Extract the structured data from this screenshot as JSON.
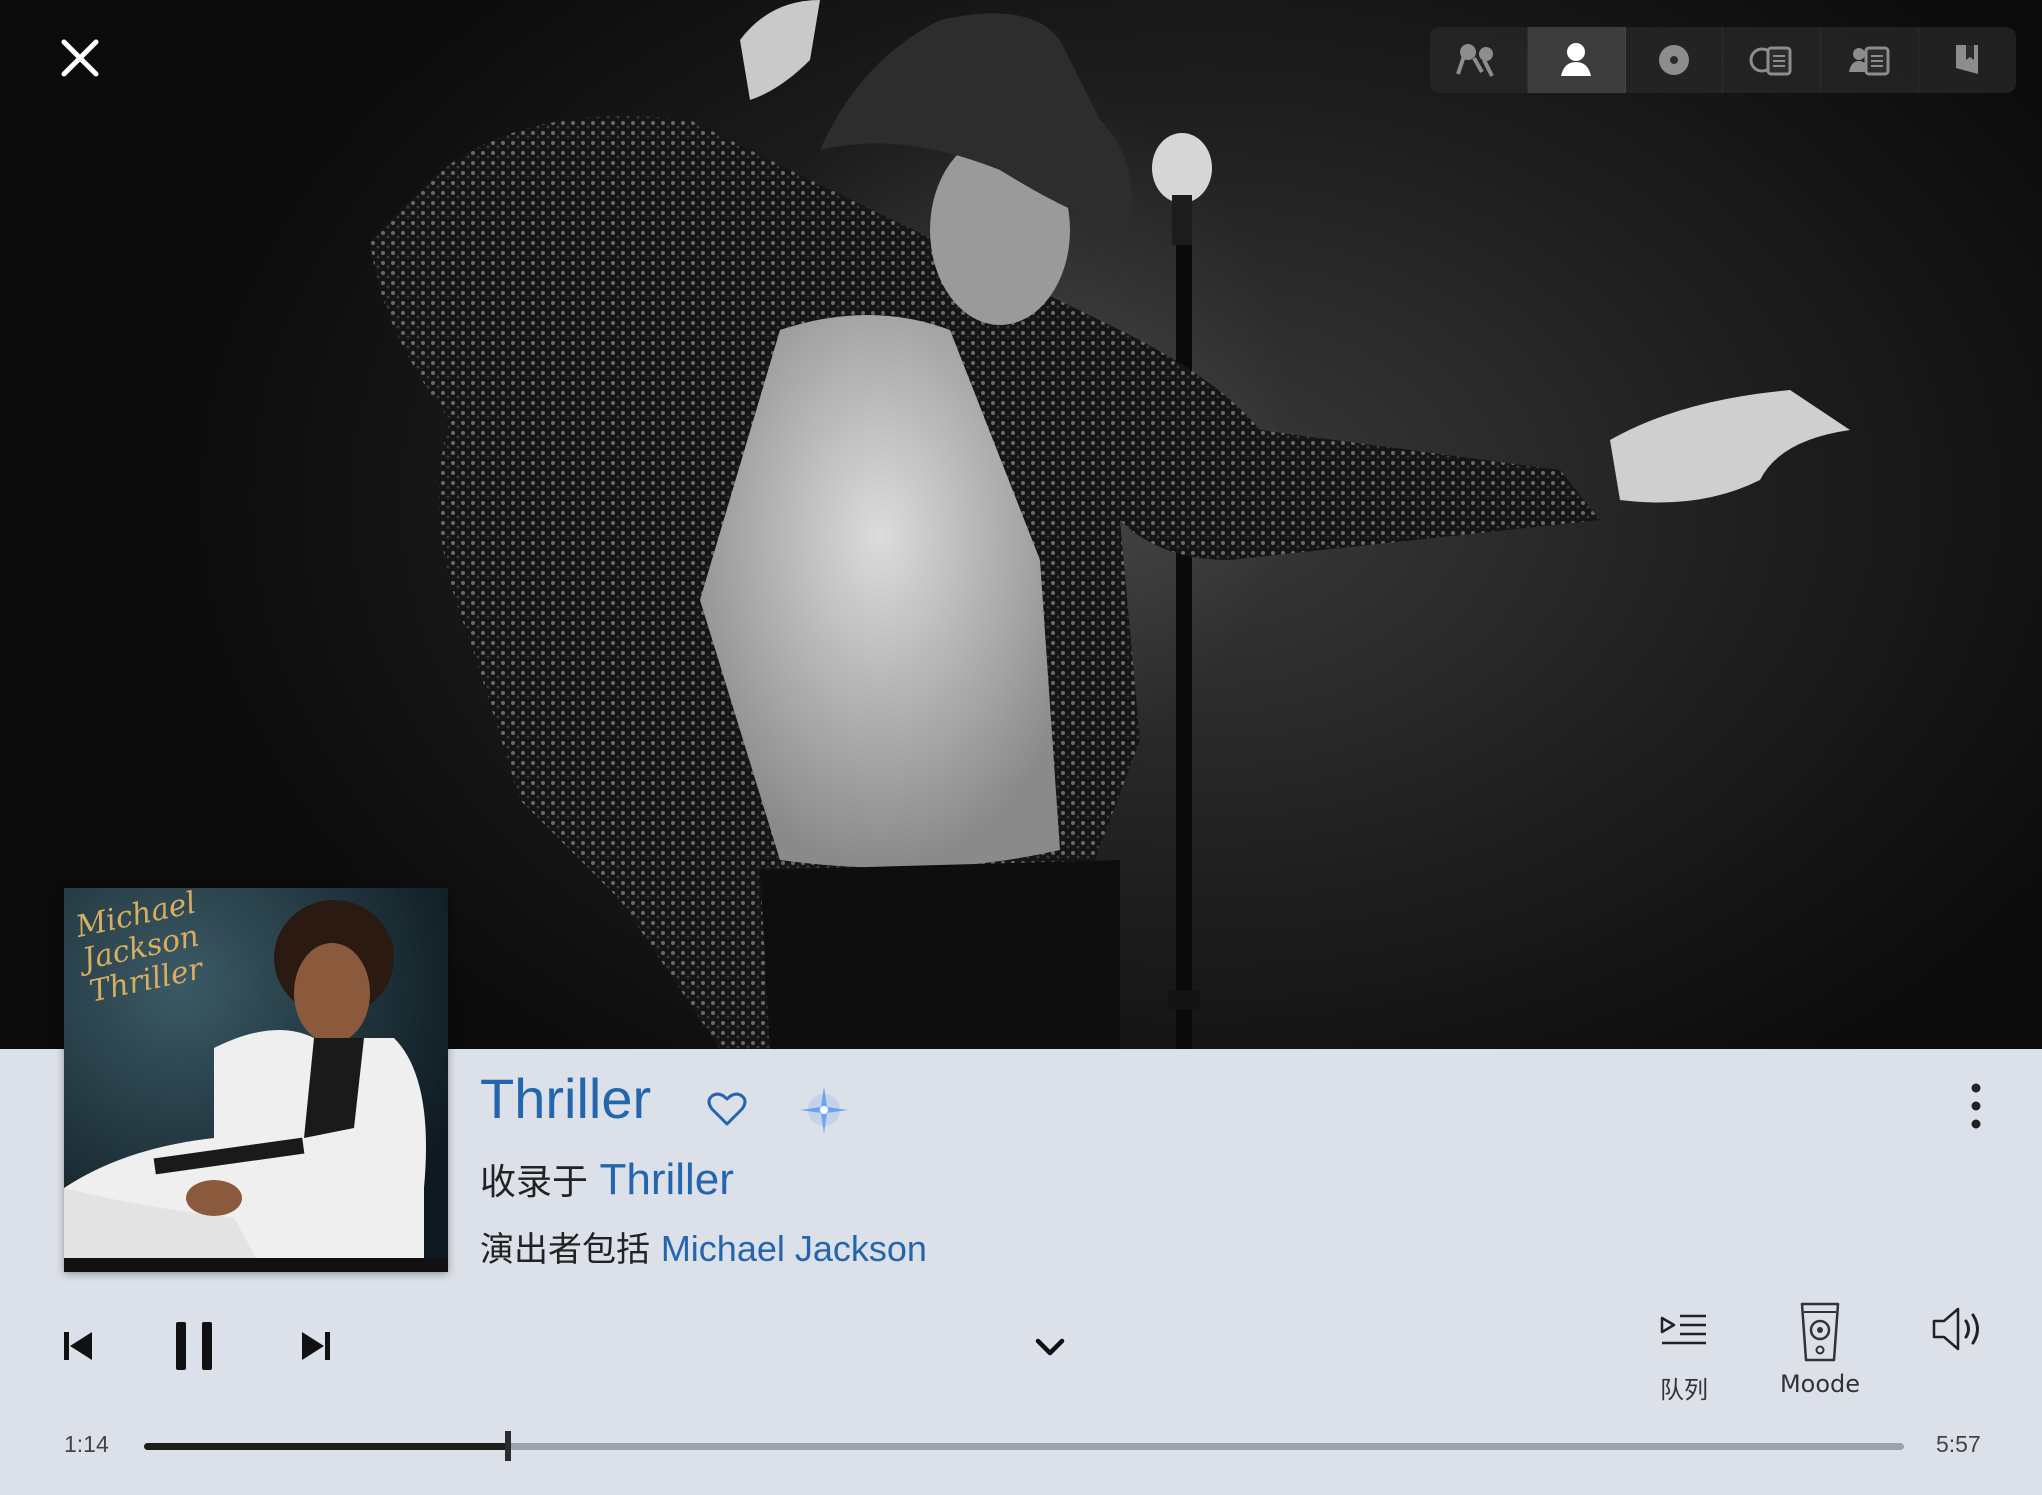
{
  "topbar": {
    "close_icon": "close-icon",
    "view_buttons": [
      {
        "name": "mic-view-icon",
        "active": false
      },
      {
        "name": "artist-view-icon",
        "active": true
      },
      {
        "name": "disc-view-icon",
        "active": false
      },
      {
        "name": "album-info-view-icon",
        "active": false
      },
      {
        "name": "artist-info-view-icon",
        "active": false
      },
      {
        "name": "bookmark-view-icon",
        "active": false
      }
    ]
  },
  "hero": {
    "image": "artist-photo"
  },
  "album_cover": {
    "script_text": "Michael Jackson Thriller"
  },
  "now_playing": {
    "title": "Thriller",
    "album_prefix": "收录于",
    "album": "Thriller",
    "artist_prefix": "演出者包括",
    "artist": "Michael Jackson"
  },
  "controls": {
    "queue_label": "队列",
    "output_label": "Moode"
  },
  "progress": {
    "elapsed": "1:14",
    "total": "5:57",
    "fraction": 0.207
  },
  "colors": {
    "accent": "#2466ad",
    "panel_bg": "#dce0e8"
  }
}
